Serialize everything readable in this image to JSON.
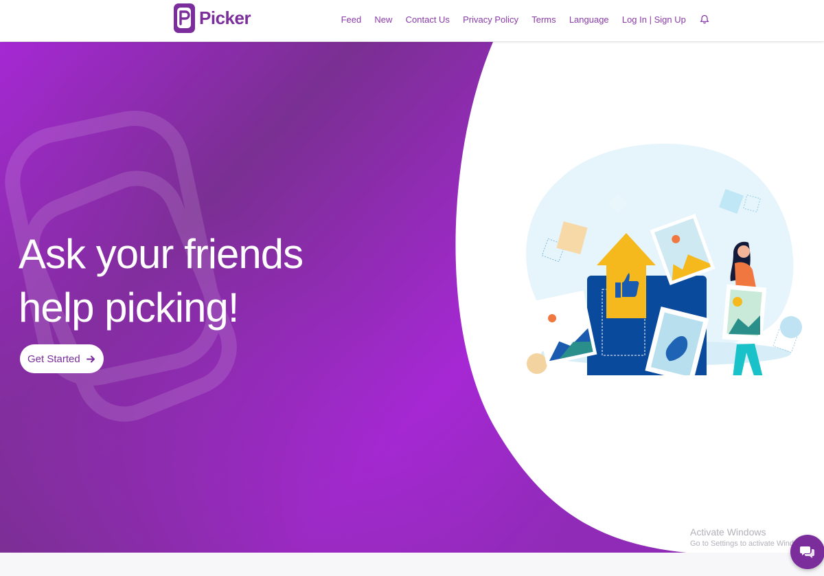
{
  "brand": {
    "name": "Picker",
    "color": "#7b2d9c"
  },
  "nav": {
    "items": [
      {
        "label": "Feed"
      },
      {
        "label": "New"
      },
      {
        "label": "Contact Us"
      },
      {
        "label": "Privacy Policy"
      },
      {
        "label": "Terms"
      },
      {
        "label": "Language"
      }
    ],
    "auth_label": "Log In | Sign Up",
    "notifications_icon": "bell-icon"
  },
  "hero": {
    "title_line1": "Ask your friends",
    "title_line2": "help picking!",
    "cta_label": "Get Started",
    "cta_icon": "arrow-right-icon",
    "gradient": [
      "#7a2f92",
      "#a628d4"
    ]
  },
  "watermark": {
    "title": "Activate Windows",
    "subtitle": "Go to Settings to activate Windows."
  },
  "chat": {
    "icon": "chat-bubbles-icon"
  }
}
